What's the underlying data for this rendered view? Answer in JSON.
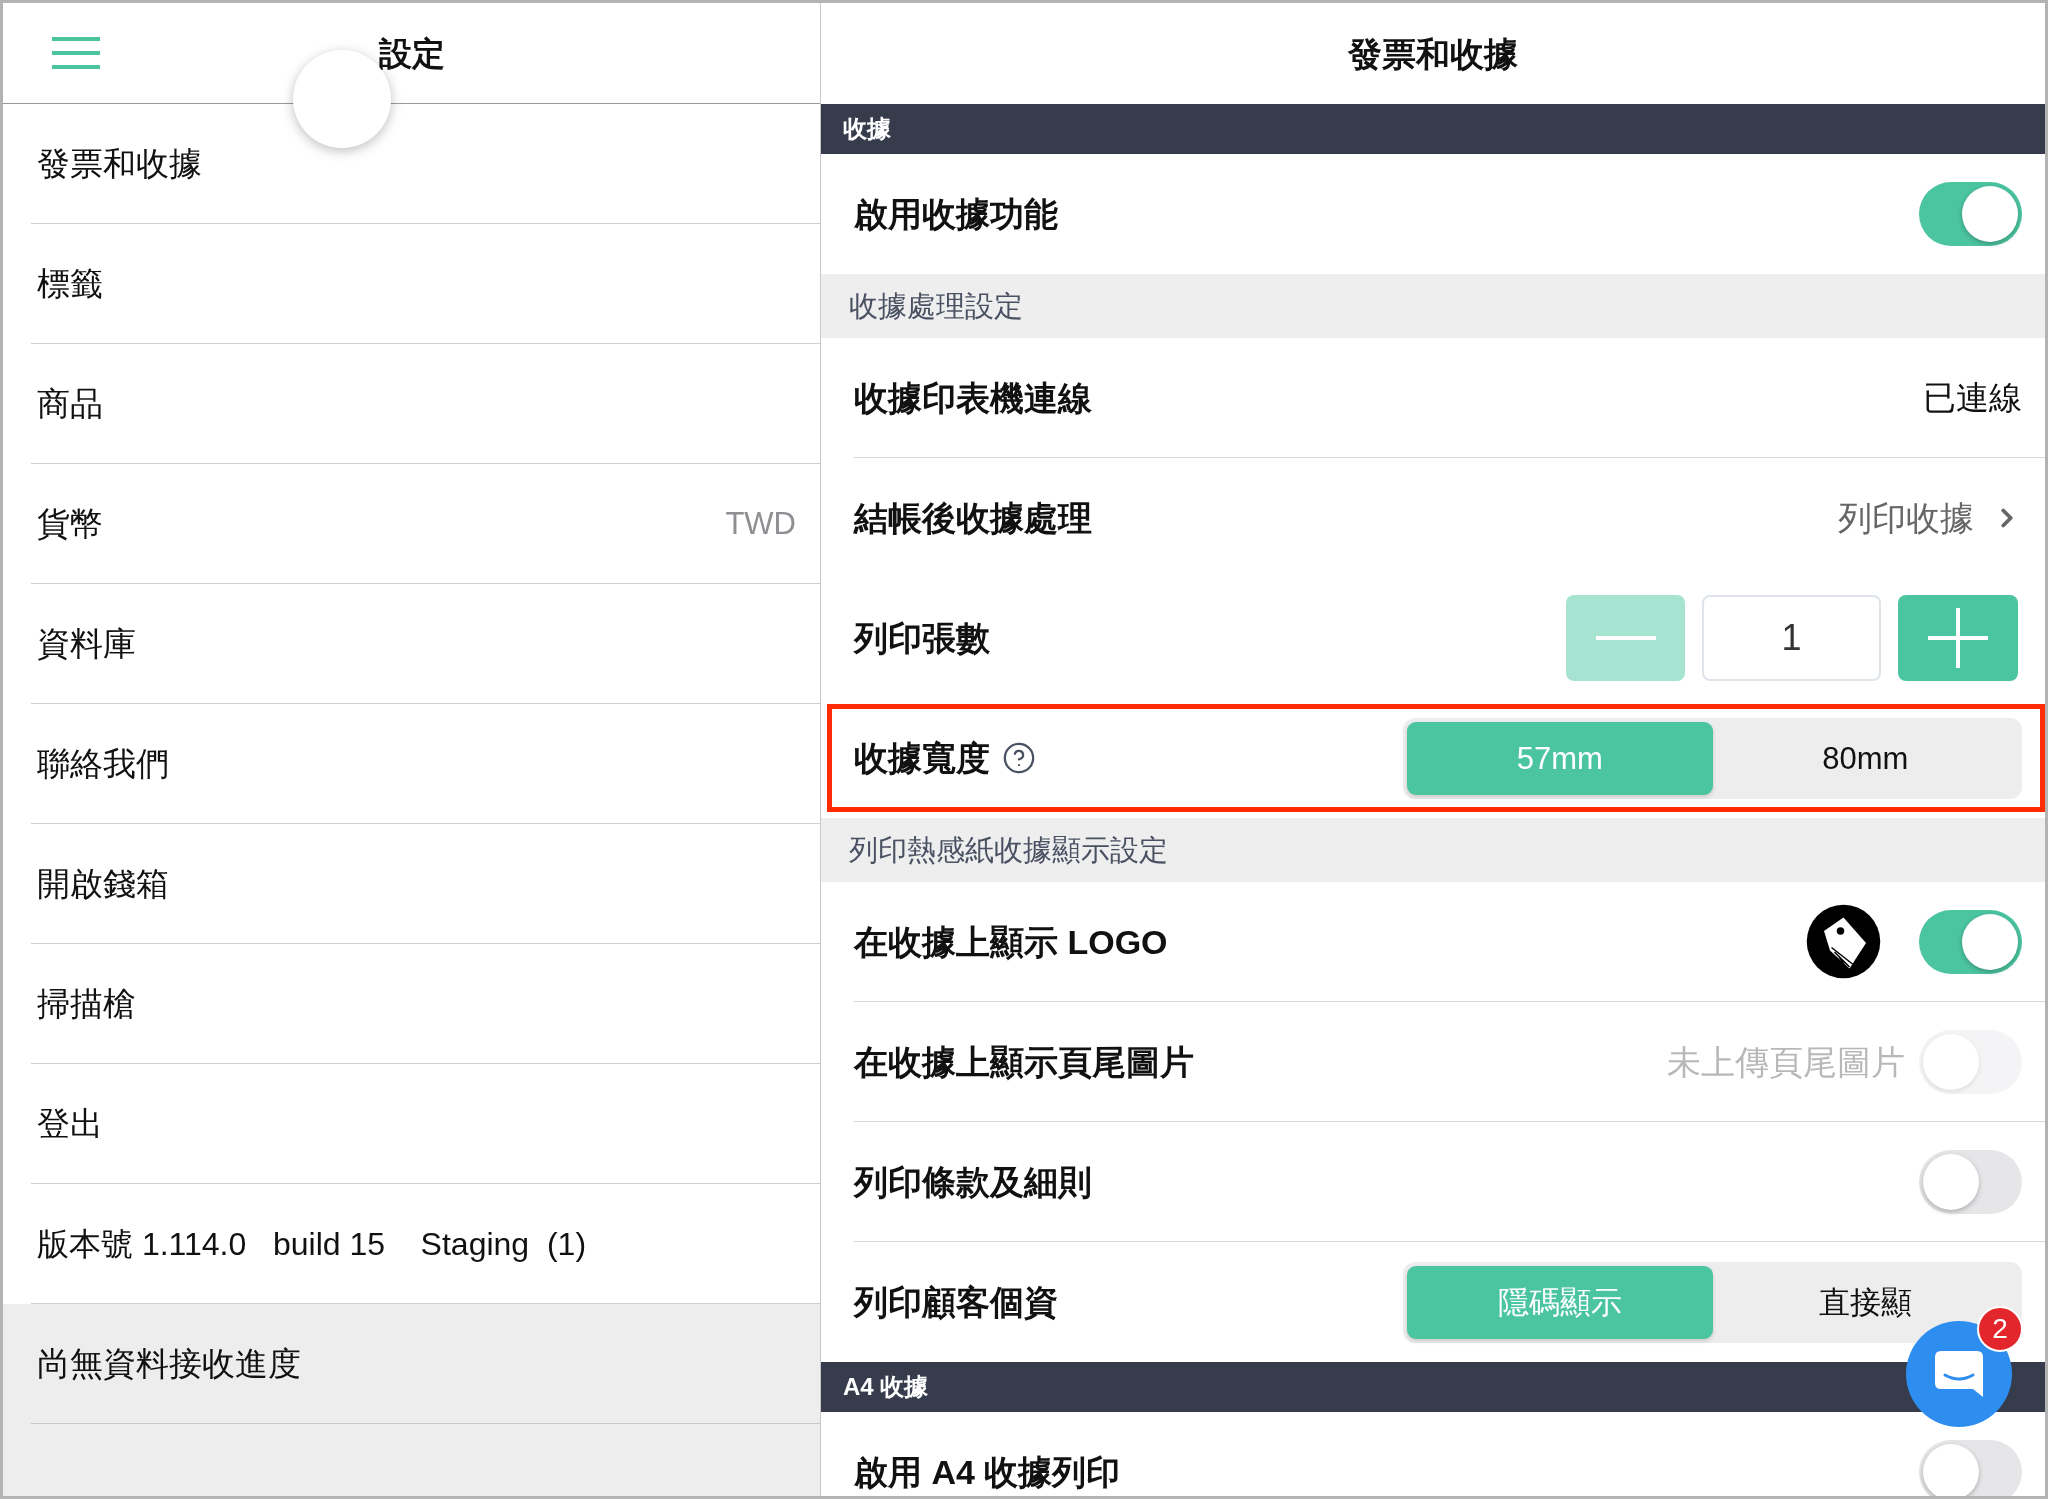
{
  "left_panel": {
    "title": "設定",
    "items": [
      {
        "label": "發票和收據"
      },
      {
        "label": "標籤"
      },
      {
        "label": "商品"
      },
      {
        "label": "貨幣",
        "value": "TWD"
      },
      {
        "label": "資料庫"
      },
      {
        "label": "聯絡我們"
      },
      {
        "label": "開啟錢箱"
      },
      {
        "label": "掃描槍"
      },
      {
        "label": "登出"
      }
    ],
    "version": "版本號 1.114.0   build 15    Staging  (1)",
    "sync_status": "尚無資料接收進度"
  },
  "right_panel": {
    "title": "發票和收據",
    "rows": [
      {
        "kind": "section",
        "title": "收據"
      },
      {
        "kind": "toggle",
        "label": "啟用收據功能",
        "on": true
      },
      {
        "kind": "group",
        "title": "收據處理設定"
      },
      {
        "kind": "value",
        "label": "收據印表機連線",
        "value": "已連線"
      },
      {
        "kind": "link",
        "label": "結帳後收據處理",
        "value": "列印收據"
      },
      {
        "kind": "stepper",
        "label": "列印張數",
        "value": "1",
        "decrement_disabled": true
      },
      {
        "kind": "segmented",
        "label": "收據寬度",
        "help": true,
        "highlighted": true,
        "options": [
          {
            "label": "57mm",
            "selected": true
          },
          {
            "label": "80mm",
            "selected": false
          }
        ]
      },
      {
        "kind": "group",
        "title": "列印熱感紙收據顯示設定"
      },
      {
        "kind": "toggle",
        "label": "在收據上顯示 LOGO",
        "logo": true,
        "on": true
      },
      {
        "kind": "toggle",
        "label": "在收據上顯示頁尾圖片",
        "note": "未上傳頁尾圖片",
        "on": false,
        "disabled": true
      },
      {
        "kind": "toggle",
        "label": "列印條款及細則",
        "on": false
      },
      {
        "kind": "segmented",
        "label": "列印顧客個資",
        "options": [
          {
            "label": "隱碼顯示",
            "selected": true
          },
          {
            "label": "直接顯",
            "selected": false
          }
        ]
      },
      {
        "kind": "section",
        "title": "A4 收據"
      },
      {
        "kind": "toggle",
        "label": "啟用 A4 收據列印",
        "on": false
      }
    ]
  },
  "chat_button": {
    "badge": "2"
  }
}
